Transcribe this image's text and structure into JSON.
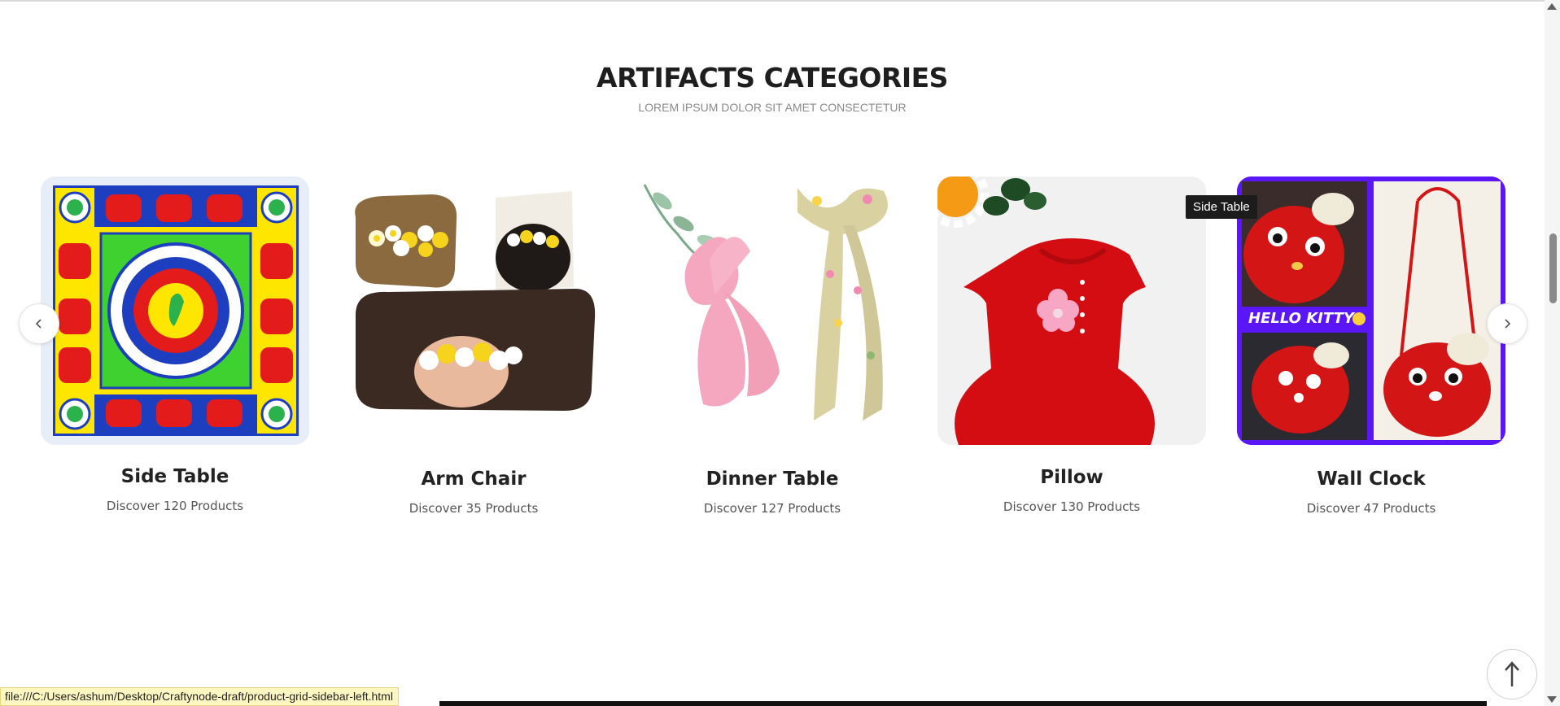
{
  "section": {
    "title": "ARTIFACTS CATEGORIES",
    "subtitle": "LOREM IPSUM DOLOR SIT AMET CONSECTETUR"
  },
  "categories": [
    {
      "name": "Side Table",
      "count": "Discover 120 Products",
      "image": "madhubani-elephant-painting"
    },
    {
      "name": "Arm Chair",
      "count": "Discover 35 Products",
      "image": "crochet-flower-hair-clip"
    },
    {
      "name": "Dinner Table",
      "count": "Discover 127 Products",
      "image": "fabric-hair-bows"
    },
    {
      "name": "Pillow",
      "count": "Discover 130 Products",
      "image": "red-crochet-baby-dress"
    },
    {
      "name": "Wall Clock",
      "count": "Discover 47 Products",
      "image": "hello-kitty-crochet-bag",
      "image_text": "HELLO KITTY"
    }
  ],
  "tooltip": "Side Table",
  "nav": {
    "prev_icon": "chevron-left-icon",
    "next_icon": "chevron-right-icon"
  },
  "back_to_top_icon": "arrow-up-icon",
  "status_url": "file:///C:/Users/ashum/Desktop/Craftynode-draft/product-grid-sidebar-left.html",
  "colors": {
    "accent_purple": "#5b16f5",
    "crochet_red": "#d4141a",
    "status_bg": "#fff7c2"
  }
}
